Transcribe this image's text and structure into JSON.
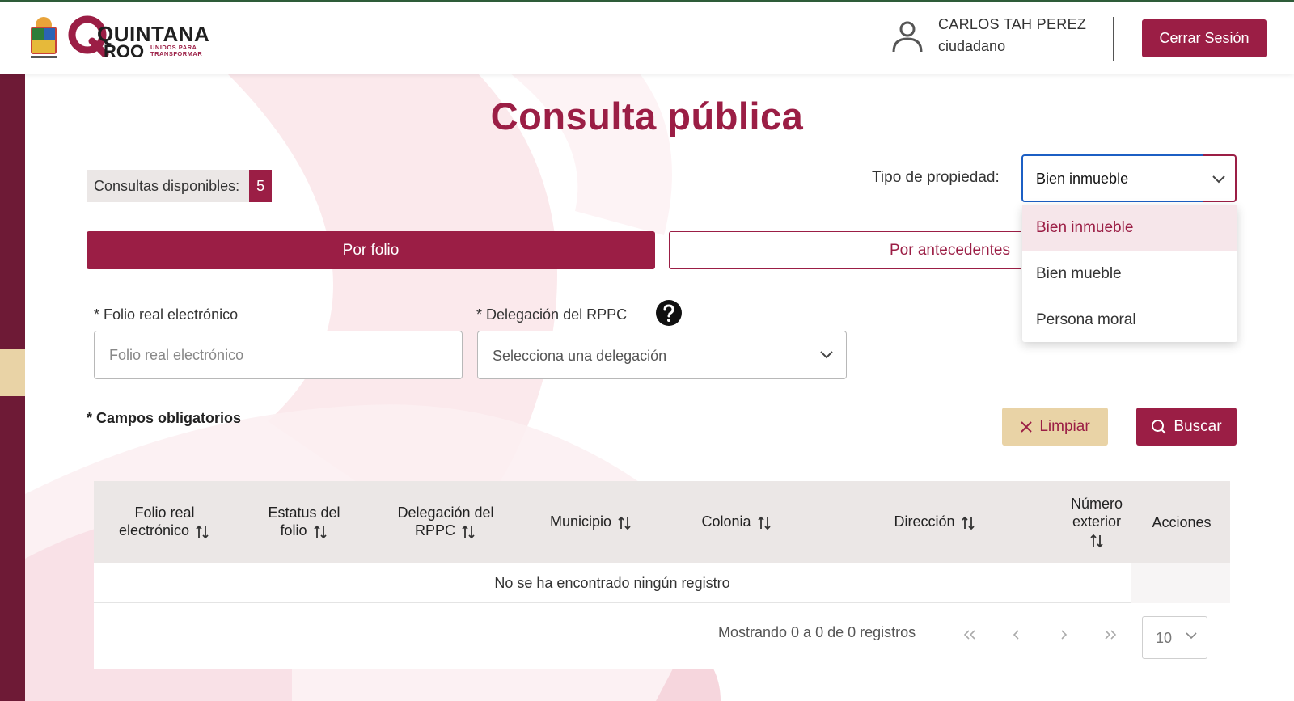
{
  "header": {
    "brand_main": "QUINTANA",
    "brand_roo": "ROO",
    "brand_tagline": "UNIDOS PARA TRANSFORMAR",
    "user_name": "CARLOS TAH PEREZ",
    "user_role": "ciudadano",
    "logout_label": "Cerrar Sesión"
  },
  "page": {
    "title": "Consulta pública",
    "quota_label": "Consultas disponibles:",
    "quota_count": "5"
  },
  "property_type": {
    "label": "Tipo de propiedad:",
    "selected": "Bien inmueble",
    "options": [
      "Bien inmueble",
      "Bien mueble",
      "Persona moral"
    ],
    "active_index": 0
  },
  "tabs": {
    "folio_label": "Por folio",
    "antecedentes_label": "Por antecedentes"
  },
  "form": {
    "folio_label": "* Folio real electrónico",
    "folio_placeholder": "Folio real electrónico",
    "delegacion_label": "* Delegación del RPPC",
    "delegacion_placeholder": "Selecciona una delegación",
    "required_note": "* Campos obligatorios",
    "clear_label": "Limpiar",
    "search_label": "Buscar"
  },
  "table": {
    "columns": [
      {
        "line1": "Folio real",
        "line2": "electrónico"
      },
      {
        "line1": "Estatus del",
        "line2": "folio"
      },
      {
        "line1": "Delegación del",
        "line2": "RPPC"
      },
      {
        "line1": "Municipio",
        "line2": ""
      },
      {
        "line1": "Colonia",
        "line2": ""
      },
      {
        "line1": "Dirección",
        "line2": ""
      },
      {
        "line1": "Número",
        "line2": "exterior"
      },
      {
        "line1": "Acciones",
        "line2": ""
      }
    ],
    "empty_message": "No se ha encontrado ningún registro",
    "pagination_text": "Mostrando 0 a 0 de 0 registros",
    "page_size": "10"
  },
  "colors": {
    "primary": "#9b1e45",
    "sidebar": "#6e1a36",
    "secondary": "#e9d3a6",
    "focus": "#1c5fc4"
  }
}
